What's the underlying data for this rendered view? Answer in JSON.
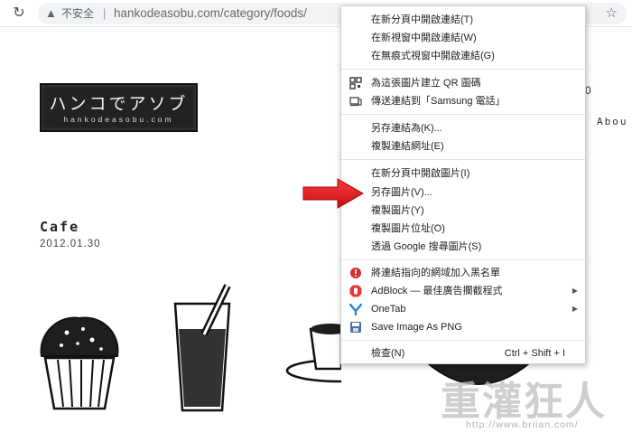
{
  "browser": {
    "security_label": "不安全",
    "url": "hankodeasobu.com/category/foods/"
  },
  "page": {
    "logo_main": "ハンコでアソブ",
    "logo_sub": "hankodeasobu.com",
    "nav_about": "Abou",
    "stub_number": "0",
    "post_title": "Cafe",
    "post_date": "2012.01.30"
  },
  "context_menu": {
    "items": [
      {
        "label": "在新分頁中開啟連結(T)"
      },
      {
        "label": "在新視窗中開啟連結(W)"
      },
      {
        "label": "在無痕式視窗中開啟連結(G)"
      },
      {
        "label": "為這張圖片建立 QR 圖碼",
        "icon": "qr-code-icon"
      },
      {
        "label": "傳送連結到「Samsung 電話」",
        "icon": "devices-icon"
      },
      {
        "label": "另存連結為(K)..."
      },
      {
        "label": "複製連結網址(E)"
      },
      {
        "label": "在新分頁中開啟圖片(I)"
      },
      {
        "label": "另存圖片(V)..."
      },
      {
        "label": "複製圖片(Y)"
      },
      {
        "label": "複製圖片位址(O)"
      },
      {
        "label": "透過 Google 搜尋圖片(S)"
      },
      {
        "label": "將連結指向的網域加入黑名單",
        "icon": "blacklist-icon"
      },
      {
        "label": "AdBlock — 最佳廣告攔截程式",
        "icon": "adblock-icon"
      },
      {
        "label": "OneTab",
        "icon": "onetab-icon"
      },
      {
        "label": "Save Image As PNG",
        "icon": "save-png-icon"
      },
      {
        "label": "檢查(N)",
        "shortcut": "Ctrl + Shift + I"
      }
    ]
  },
  "watermark": {
    "text": "重灌狂人",
    "url": "http://www.briian.com/"
  },
  "colors": {
    "highlight_arrow": "#e8141b",
    "blacklist": "#d32f2f",
    "adblock": "#e53935",
    "onetab": "#2f7fd6"
  }
}
